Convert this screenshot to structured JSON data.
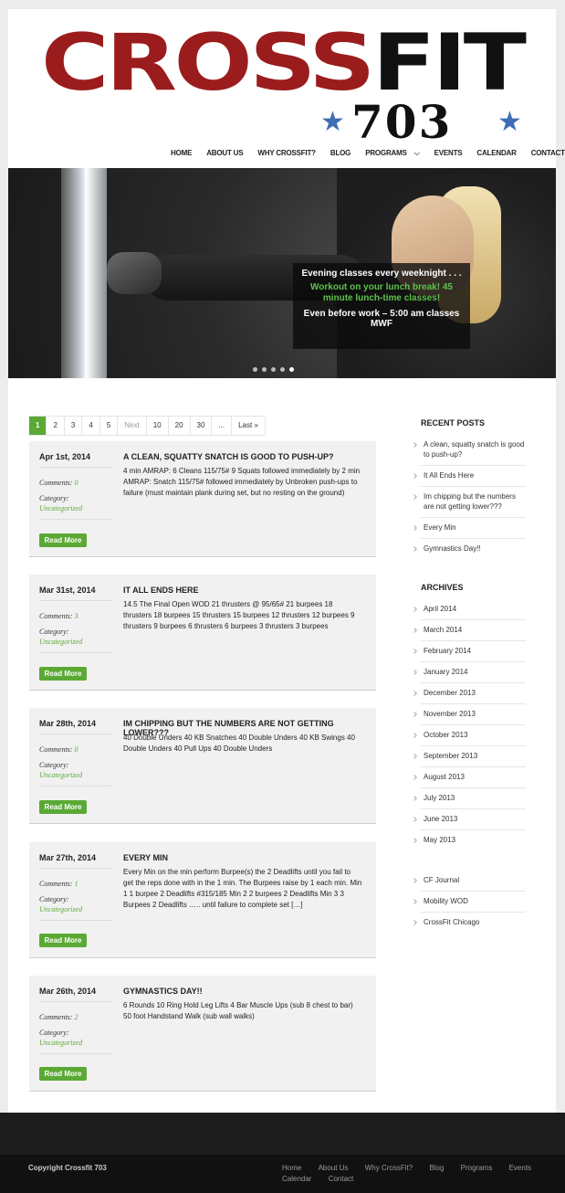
{
  "header": {
    "logo": {
      "word1": "CROSS",
      "word2": "FIT",
      "number": "703",
      "star": "★"
    },
    "nav": [
      {
        "label": "HOME"
      },
      {
        "label": "ABOUT US"
      },
      {
        "label": "WHY CROSSFIT?"
      },
      {
        "label": "BLOG"
      },
      {
        "label": "PROGRAMS",
        "has_dropdown": true
      },
      {
        "label": "EVENTS"
      },
      {
        "label": "CALENDAR"
      },
      {
        "label": "CONTACT"
      }
    ],
    "nav_caret": "⌵"
  },
  "slider": {
    "caption_line1": "Evening classes every weeknight . . .",
    "caption_line2": "Workout on your lunch break! 45 minute lunch-time classes!",
    "caption_line3": "Even before work – 5:00 am classes MWF",
    "slide_count": 5,
    "active_slide": 5,
    "accent_color": "#5cc24a"
  },
  "pagination": [
    "1",
    "2",
    "3",
    "4",
    "5",
    "Next",
    "10",
    "20",
    "30",
    "...",
    "Last »"
  ],
  "pagination_active": "1",
  "posts": [
    {
      "date": "Apr 1st, 2014",
      "comments_label": "Comments:",
      "comments": "0",
      "category_label": "Category:",
      "category": "Uncategorized",
      "title": "A CLEAN, SQUATTY SNATCH IS GOOD TO PUSH-UP?",
      "body": "4 min AMRAP: 6 Cleans 115/75# 9 Squats   followed immediately by 2 min AMRAP: Snatch 115/75#   followed immediately by Unbroken push-ups to failure (must maintain plank during set, but no resting on the ground)",
      "read_more": "Read More"
    },
    {
      "date": "Mar 31st, 2014",
      "comments_label": "Comments:",
      "comments": "3",
      "category_label": "Category:",
      "category": "Uncategorized",
      "title": "IT ALL ENDS HERE",
      "body": "14.5 The Final Open WOD   21 thrusters @ 95/65# 21 burpees 18 thrusters 18 burpees 15 thrusters 15 burpees 12 thrusters 12 burpees 9 thrusters 9 burpees 6 thrusters 6 burpees 3 thrusters 3 burpees",
      "read_more": "Read More"
    },
    {
      "date": "Mar 28th, 2014",
      "comments_label": "Comments:",
      "comments": "0",
      "category_label": "Category:",
      "category": "Uncategorized",
      "title": "IM CHIPPING BUT THE NUMBERS ARE NOT GETTING LOWER???",
      "body": "40 Double Unders 40 KB Snatches 40 Double Unders 40 KB Swings 40 Double Unders 40 Pull Ups 40 Double Unders",
      "read_more": "Read More"
    },
    {
      "date": "Mar 27th, 2014",
      "comments_label": "Comments:",
      "comments": "1",
      "category_label": "Category:",
      "category": "Uncategorized",
      "title": "EVERY MIN",
      "body": "Every Min on the min perform Burpee(s) the 2 Deadlifts until you fail to get the reps done with in the 1 min. The Burpees raise by 1 each min. Min 1 1 burpee 2 Deadlifts #315/185 Min 2 2 burpees 2 Deadlifts Min 3 3 Burpees 2 Deadlifts ….. until failure to complete set […]",
      "read_more": "Read More"
    },
    {
      "date": "Mar 26th, 2014",
      "comments_label": "Comments:",
      "comments": "2",
      "category_label": "Category:",
      "category": "Uncategorized",
      "title": "GYMNASTICS DAY!!",
      "body": "6 Rounds 10 Ring Hold Leg Lifts 4 Bar Muscle Ups (sub 8 chest to bar) 50 foot Handstand Walk (sub wall walks)",
      "read_more": "Read More"
    }
  ],
  "sidebar": {
    "recent_title": "RECENT POSTS",
    "recent": [
      "A clean, squatty snatch is good to push-up?",
      "It All Ends Here",
      "Im chipping but the numbers are not getting lower???",
      "Every Min",
      "Gymnastics Day!!"
    ],
    "archives_title": "ARCHIVES",
    "archives": [
      "April 2014",
      "March 2014",
      "February 2014",
      "January 2014",
      "December 2013",
      "November 2013",
      "October 2013",
      "September 2013",
      "August 2013",
      "July 2013",
      "June 2013",
      "May 2013"
    ],
    "links": [
      "CF Journal",
      "Mobility WOD",
      "CrossFit Chicago"
    ]
  },
  "footer": {
    "copyright": "Copyright Crossfit 703",
    "links": [
      "Home",
      "About Us",
      "Why CrossFit?",
      "Blog",
      "Programs",
      "Events",
      "Calendar",
      "Contact"
    ]
  },
  "colors": {
    "brand_red": "#9b1c1c",
    "star_blue": "#3f6fb3",
    "accent_green": "#5aa935"
  }
}
